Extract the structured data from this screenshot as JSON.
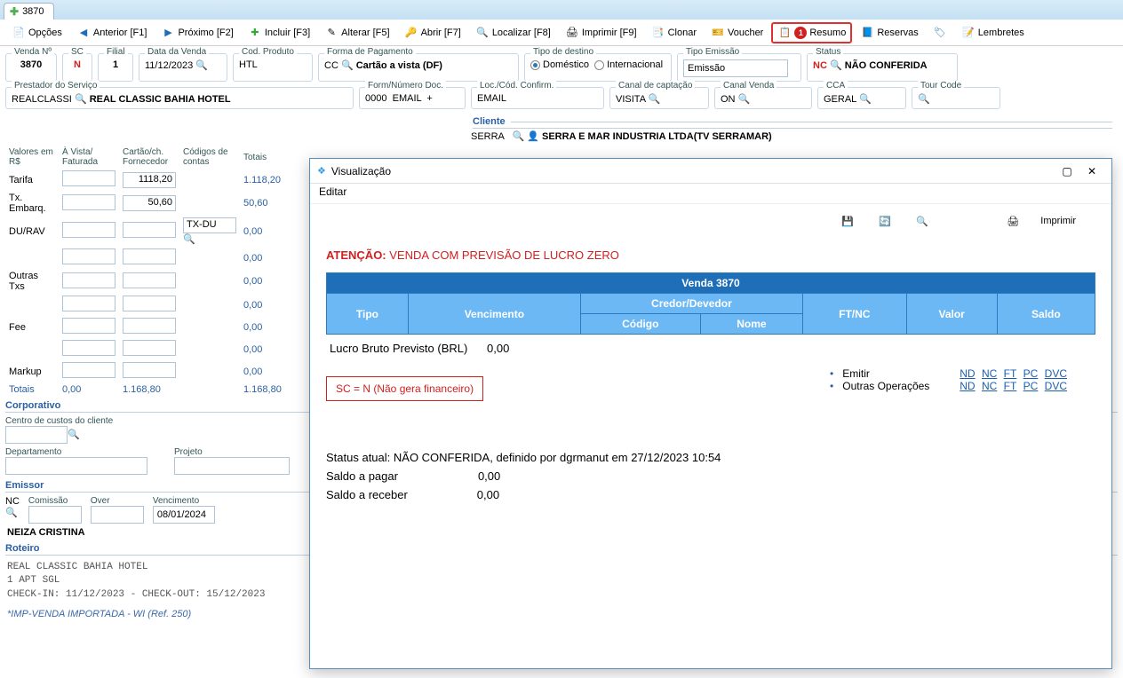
{
  "tab": {
    "label": "3870"
  },
  "toolbar": {
    "opcoes": "Opções",
    "anterior": "Anterior [F1]",
    "proximo": "Próximo [F2]",
    "incluir": "Incluir [F3]",
    "alterar": "Alterar [F5]",
    "abrir": "Abrir [F7]",
    "localizar": "Localizar [F8]",
    "imprimir": "Imprimir [F9]",
    "clonar": "Clonar",
    "voucher": "Voucher",
    "resumo": "Resumo",
    "resumo_badge": "1",
    "reservas": "Reservas",
    "lembretes": "Lembretes"
  },
  "fields": {
    "venda_no": {
      "label": "Venda Nº",
      "value": "3870"
    },
    "sc": {
      "label": "SC",
      "value": "N"
    },
    "filial": {
      "label": "Filial",
      "value": "1"
    },
    "data_venda": {
      "label": "Data da Venda",
      "value": "11/12/2023"
    },
    "cod_produto": {
      "label": "Cod. Produto",
      "value": "HTL"
    },
    "forma_pagamento": {
      "label": "Forma de Pagamento",
      "code": "CC",
      "desc": "Cartão a vista (DF)"
    },
    "tipo_destino": {
      "label": "Tipo de destino",
      "opt1": "Doméstico",
      "opt2": "Internacional"
    },
    "tipo_emissao": {
      "label": "Tipo Emissão",
      "value": "Emissão"
    },
    "status": {
      "label": "Status",
      "code": "NC",
      "desc": "NÃO CONFERIDA"
    },
    "prestador": {
      "label": "Prestador do Serviço",
      "code": "REALCLASSI",
      "name": "REAL CLASSIC BAHIA HOTEL"
    },
    "form_num_doc": {
      "label": "Form/Número Doc.",
      "code": "0000",
      "desc": "EMAIL",
      "plus": "+"
    },
    "loc_cod": {
      "label": "Loc./Cód. Confirm.",
      "value": "EMAIL"
    },
    "canal_capt": {
      "label": "Canal de captação",
      "value": "VISITA"
    },
    "canal_venda": {
      "label": "Canal Venda",
      "value": "ON"
    },
    "cca": {
      "label": "CCA",
      "value": "GERAL"
    },
    "tour_code": {
      "label": "Tour Code",
      "value": ""
    }
  },
  "cliente": {
    "heading": "Cliente",
    "code": "SERRA",
    "name": "SERRA E MAR INDUSTRIA LTDA(TV SERRAMAR)"
  },
  "values": {
    "header": {
      "col0": "Valores em R$",
      "col1": "À Vista/ Faturada",
      "col2": "Cartão/ch. Fornecedor",
      "col3": "Códigos de contas",
      "totais": "Totais"
    },
    "rows": [
      {
        "label": "Tarifa",
        "v1": "",
        "v2": "1118,20",
        "total": "1.118,20"
      },
      {
        "label": "Tx. Embarq.",
        "v1": "",
        "v2": "50,60",
        "total": "50,60"
      },
      {
        "label": "DU/RAV",
        "v1": "",
        "v2": "",
        "code": "TX-DU",
        "total": "0,00"
      },
      {
        "label": "",
        "v1": "",
        "v2": "",
        "total": "0,00"
      },
      {
        "label": "Outras Txs",
        "v1": "",
        "v2": "",
        "total": "0,00"
      },
      {
        "label": "",
        "v1": "",
        "v2": "",
        "total": "0,00"
      },
      {
        "label": "Fee",
        "v1": "",
        "v2": "",
        "total": "0,00"
      },
      {
        "label": "",
        "v1": "",
        "v2": "",
        "total": "0,00"
      },
      {
        "label": "Markup",
        "v1": "",
        "v2": "",
        "total": "0,00"
      }
    ],
    "totais_row": {
      "label": "Totais",
      "v1": "0,00",
      "v2": "1.168,80",
      "total": "1.168,80"
    }
  },
  "corporativo": {
    "heading": "Corporativo",
    "centro_custos": "Centro de custos do cliente",
    "departamento": "Departamento",
    "projeto": "Projeto"
  },
  "emissor": {
    "heading": "Emissor",
    "code": "NC",
    "comissao_label": "Comissão",
    "over_label": "Over",
    "venc_label": "Vencimento",
    "venc_value": "08/01/2024",
    "name": "NEIZA CRISTINA"
  },
  "roteiro": {
    "heading": "Roteiro",
    "line1": "REAL CLASSIC BAHIA HOTEL",
    "line2": "1 APT  SGL",
    "line3": "CHECK-IN: 11/12/2023 -  CHECK-OUT: 15/12/2023"
  },
  "import_note": "*IMP-VENDA IMPORTADA - WI (Ref. 250)",
  "modal": {
    "title": "Visualização",
    "menu_editar": "Editar",
    "btn_imprimir": "Imprimir",
    "warn_prefix": "ATENÇÃO:",
    "warn_text": "VENDA COM PREVISÃO DE LUCRO ZERO",
    "table": {
      "title": "Venda  3870",
      "tipo": "Tipo",
      "venc": "Vencimento",
      "credev": "Credor/Devedor",
      "codigo": "Código",
      "nome": "Nome",
      "ftnc": "FT/NC",
      "valor": "Valor",
      "saldo": "Saldo"
    },
    "lucro_label": "Lucro Bruto Previsto (BRL)",
    "lucro_value": "0,00",
    "sc_text": "SC = N (Não gera financeiro)",
    "emitir": "Emitir",
    "outras": "Outras Operações",
    "links": {
      "nd": "ND",
      "nc": "NC",
      "ft": "FT",
      "pc": "PC",
      "dvc": "DVC"
    },
    "status_line": "Status atual: NÃO CONFERIDA, definido por dgrmanut em 27/12/2023 10:54",
    "saldo_pagar_label": "Saldo a pagar",
    "saldo_pagar_value": "0,00",
    "saldo_receber_label": "Saldo a receber",
    "saldo_receber_value": "0,00"
  }
}
